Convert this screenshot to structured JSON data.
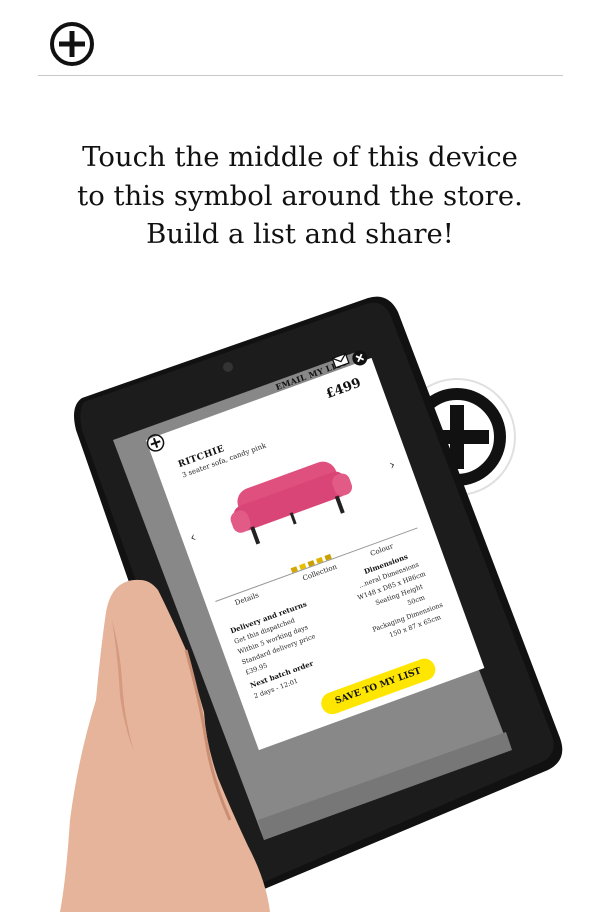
{
  "header": {
    "add_icon": "plus-circle-icon"
  },
  "headline": {
    "line1": "Touch the middle of this device",
    "line2": "to this symbol around the store.",
    "line3": "Build a list and share!"
  },
  "store_symbol": {
    "icon": "plus-circle-icon"
  },
  "tablet_app": {
    "email_label": "EMAIL MY LIST",
    "email_icon": "envelope-icon",
    "close_icon": "close-icon",
    "price": "£499",
    "product_name": "RITCHIE",
    "product_subtitle": "3 seater sofa, candy pink",
    "tabs": [
      "Details",
      "Collection",
      "Colour"
    ],
    "delivery_heading": "Delivery and returns",
    "delivery_lines": [
      "Get this dispatched",
      "Within 5 working days",
      "Standard delivery price",
      "£39.95"
    ],
    "batch_heading": "Next batch order",
    "batch_line": "2 days - 12:01",
    "dimensions_heading": "Dimensions",
    "dimensions_lines": [
      "...neral Dimensions",
      "W148 x D85 x H86cm",
      "Seating Height",
      "50cm",
      "Packaging Dimensions",
      "150 x 87 x 65cm"
    ],
    "save_button": "SAVE TO MY LIST",
    "colors": {
      "sofa": "#e0507e",
      "button": "#ffe600"
    }
  }
}
